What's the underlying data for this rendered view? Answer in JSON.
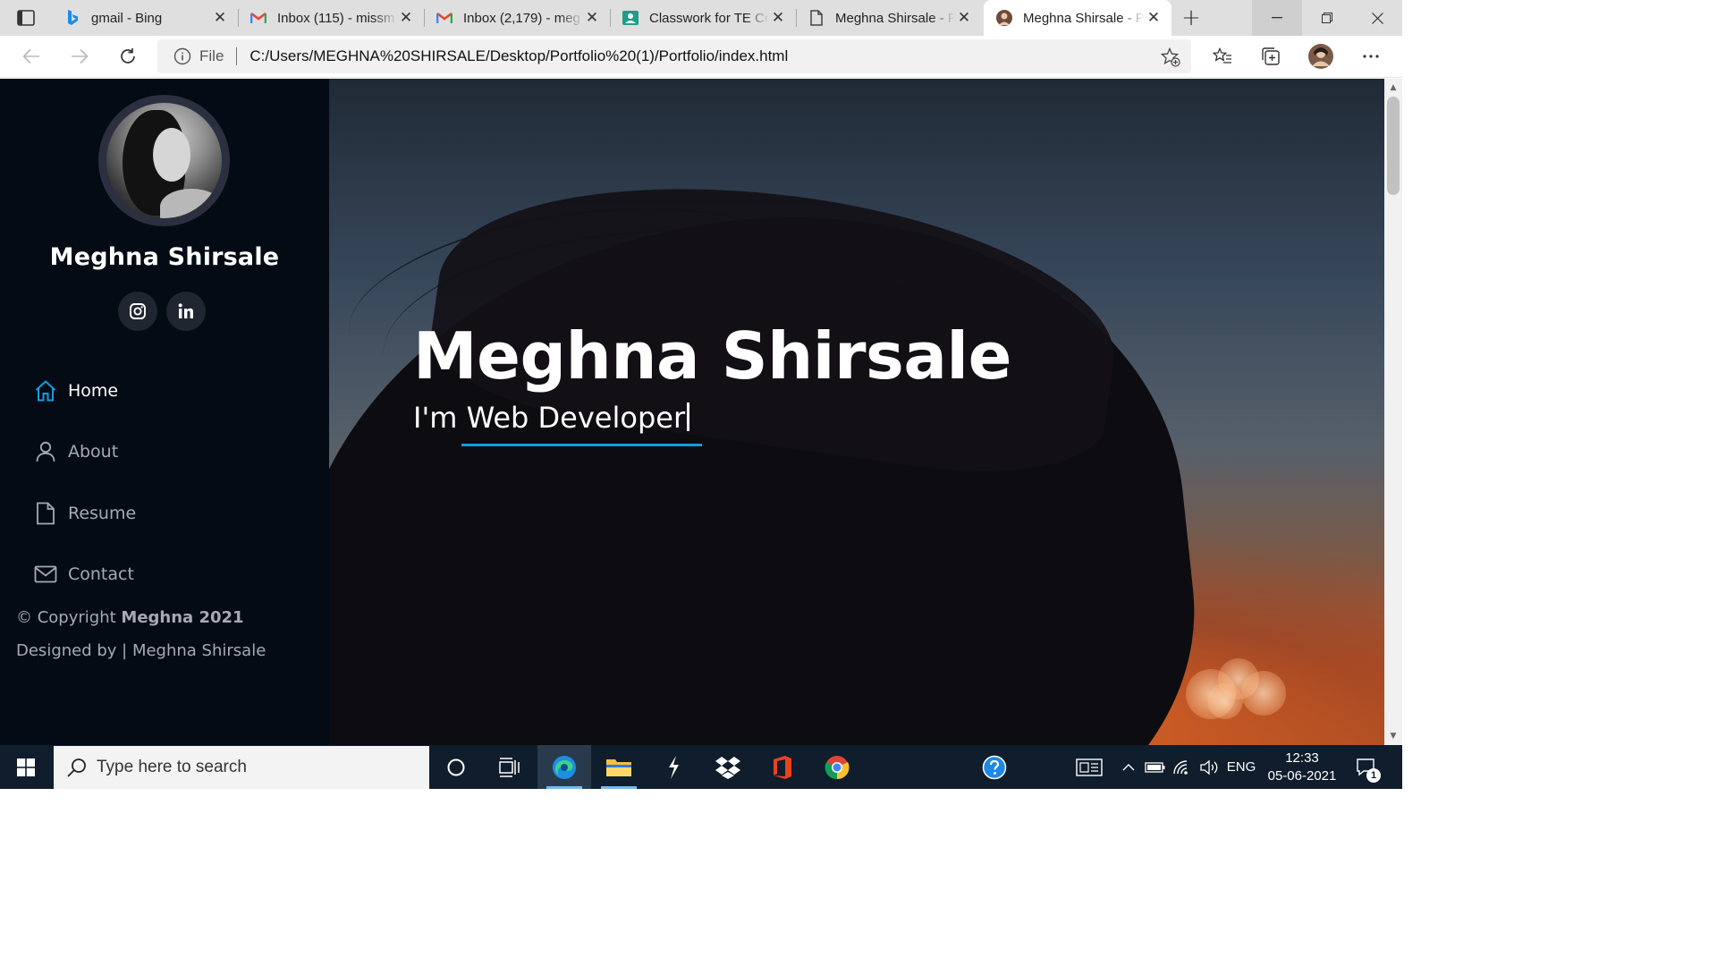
{
  "browser": {
    "tabs": [
      {
        "title": "gmail - Bing",
        "favicon": "bing-icon"
      },
      {
        "title": "Inbox (115) - missm",
        "favicon": "gmail-icon"
      },
      {
        "title": "Inbox (2,179) - meg",
        "favicon": "gmail-icon"
      },
      {
        "title": "Classwork for TE Co",
        "favicon": "classroom-icon"
      },
      {
        "title": "Meghna Shirsale - P",
        "favicon": "document-icon"
      },
      {
        "title": "Meghna Shirsale - P",
        "favicon": "avatar-icon",
        "active": true
      }
    ],
    "address": {
      "scheme": "File",
      "url": "C:/Users/MEGHNA%20SHIRSALE/Desktop/Portfolio%20(1)/Portfolio/index.html"
    }
  },
  "sidebar": {
    "name": "Meghna Shirsale",
    "social": [
      "instagram-icon",
      "linkedin-icon"
    ],
    "nav": [
      {
        "label": "Home",
        "icon": "home-icon",
        "active": true
      },
      {
        "label": "About",
        "icon": "user-icon"
      },
      {
        "label": "Resume",
        "icon": "file-icon"
      },
      {
        "label": "Contact",
        "icon": "envelope-icon"
      }
    ],
    "copyright_prefix": "© Copyright",
    "copyright_strong": "Meghna 2021",
    "credits": "Designed by | Meghna Shirsale"
  },
  "hero": {
    "title": "Meghna Shirsale",
    "subtitle": "I'm Web Developer",
    "accent_color": "#149ddd"
  },
  "taskbar": {
    "search_placeholder": "Type here to search",
    "language": "ENG",
    "time": "12:33",
    "date": "05-06-2021",
    "notification_count": "1"
  }
}
